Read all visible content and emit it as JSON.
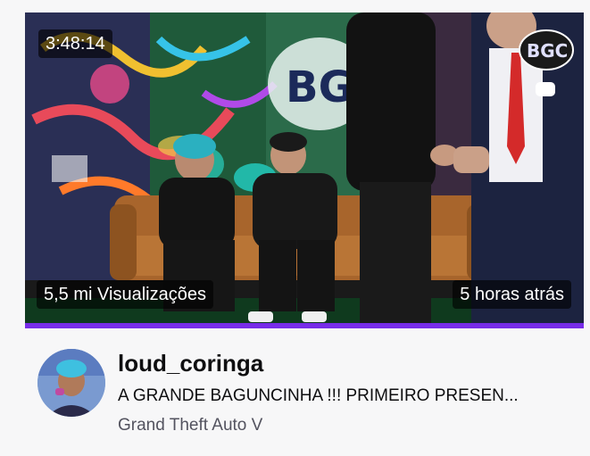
{
  "video": {
    "duration": "3:48:14",
    "views": "5,5 mi Visualizações",
    "uploaded": "5 horas atrás",
    "accent_color": "#772ce8"
  },
  "channel": {
    "name": "loud_coringa"
  },
  "stream": {
    "title": "A GRANDE BAGUNCINHA !!! PRIMEIRO PRESEN...",
    "category": "Grand Theft Auto V"
  },
  "thumbnail": {
    "logo_text": "BGC"
  }
}
